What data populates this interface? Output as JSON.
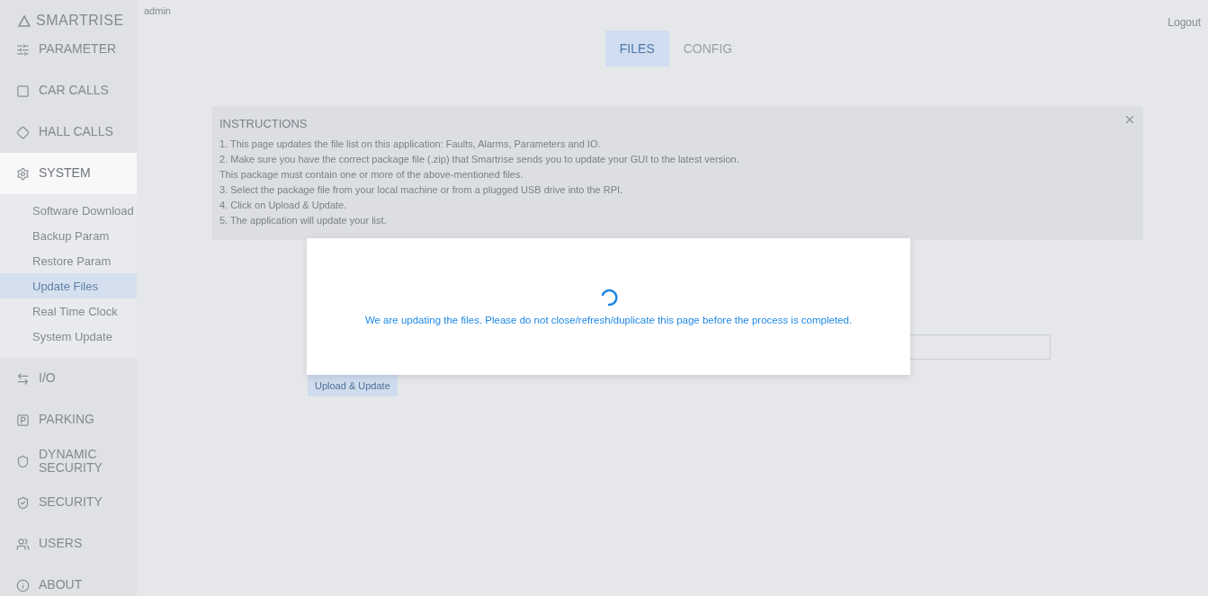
{
  "header": {
    "user": "admin",
    "logout": "Logout"
  },
  "sidebar": {
    "brand": "SMARTRISE",
    "items": [
      {
        "label": "PARAMETER",
        "selected": false
      },
      {
        "label": "CAR CALLS",
        "selected": false
      },
      {
        "label": "HALL CALLS",
        "selected": false
      },
      {
        "label": "SYSTEM",
        "selected": true,
        "children": [
          {
            "label": "Software Download",
            "selected": false
          },
          {
            "label": "Backup Param",
            "selected": false
          },
          {
            "label": "Restore Param",
            "selected": false
          },
          {
            "label": "Update Files",
            "selected": true
          },
          {
            "label": "Real Time Clock",
            "selected": false
          },
          {
            "label": "System Update",
            "selected": false
          }
        ]
      },
      {
        "label": "I/O",
        "selected": false
      },
      {
        "label": "PARKING",
        "selected": false
      },
      {
        "label": "DYNAMIC SECURITY",
        "selected": false
      },
      {
        "label": "SECURITY",
        "selected": false
      },
      {
        "label": "USERS",
        "selected": false
      },
      {
        "label": "ABOUT",
        "selected": false
      }
    ]
  },
  "tabs": [
    {
      "label": "FILES",
      "selected": true
    },
    {
      "label": "CONFIG",
      "selected": false
    }
  ],
  "instructions": {
    "title": "INSTRUCTIONS",
    "lines": [
      "1. This page updates the file list on this application: Faults, Alarms, Parameters and IO.",
      "2. Make sure you have the correct package file (.zip) that Smartrise sends you to update your GUI to the latest version.",
      "This package must contain one or more of the above-mentioned files.",
      "3. Select the package file from your local machine or from a plugged USB drive into the RPI.",
      "4. Click on Upload & Update.",
      "5. The application will update your list."
    ]
  },
  "upload": {
    "button": "Upload & Update"
  },
  "dialog": {
    "message": "We are updating the files. Please do not close/refresh/duplicate this page before the process is completed."
  }
}
